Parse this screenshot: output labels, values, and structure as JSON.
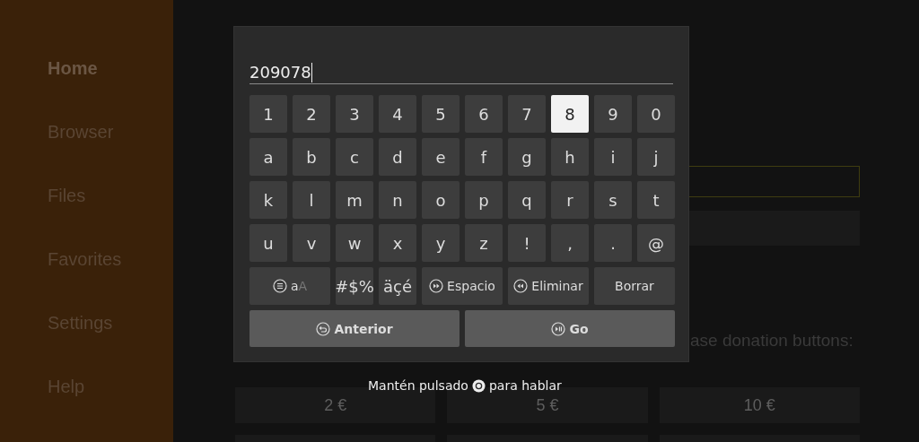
{
  "sidebar": {
    "items": [
      {
        "label": "Home",
        "selected": true
      },
      {
        "label": "Browser",
        "selected": false
      },
      {
        "label": "Files",
        "selected": false
      },
      {
        "label": "Favorites",
        "selected": false
      },
      {
        "label": "Settings",
        "selected": false
      },
      {
        "label": "Help",
        "selected": false
      }
    ]
  },
  "page": {
    "donation_text": "ase donation buttons:",
    "donation_buttons": [
      "2 €",
      "5 €",
      "10 €"
    ]
  },
  "keyboard": {
    "value": "209078",
    "rows": [
      [
        {
          "label": "1",
          "selected": false
        },
        {
          "label": "2",
          "selected": false
        },
        {
          "label": "3",
          "selected": false
        },
        {
          "label": "4",
          "selected": false
        },
        {
          "label": "5",
          "selected": false
        },
        {
          "label": "6",
          "selected": false
        },
        {
          "label": "7",
          "selected": false
        },
        {
          "label": "8",
          "selected": true
        },
        {
          "label": "9",
          "selected": false
        },
        {
          "label": "0",
          "selected": false
        }
      ],
      [
        {
          "label": "a",
          "selected": false
        },
        {
          "label": "b",
          "selected": false
        },
        {
          "label": "c",
          "selected": false
        },
        {
          "label": "d",
          "selected": false
        },
        {
          "label": "e",
          "selected": false
        },
        {
          "label": "f",
          "selected": false
        },
        {
          "label": "g",
          "selected": false
        },
        {
          "label": "h",
          "selected": false
        },
        {
          "label": "i",
          "selected": false
        },
        {
          "label": "j",
          "selected": false
        }
      ],
      [
        {
          "label": "k",
          "selected": false
        },
        {
          "label": "l",
          "selected": false
        },
        {
          "label": "m",
          "selected": false
        },
        {
          "label": "n",
          "selected": false
        },
        {
          "label": "o",
          "selected": false
        },
        {
          "label": "p",
          "selected": false
        },
        {
          "label": "q",
          "selected": false
        },
        {
          "label": "r",
          "selected": false
        },
        {
          "label": "s",
          "selected": false
        },
        {
          "label": "t",
          "selected": false
        }
      ],
      [
        {
          "label": "u",
          "selected": false
        },
        {
          "label": "v",
          "selected": false
        },
        {
          "label": "w",
          "selected": false
        },
        {
          "label": "x",
          "selected": false
        },
        {
          "label": "y",
          "selected": false
        },
        {
          "label": "z",
          "selected": false
        },
        {
          "label": "!",
          "selected": false
        },
        {
          "label": ",",
          "selected": false
        },
        {
          "label": ".",
          "selected": false
        },
        {
          "label": "@",
          "selected": false
        }
      ]
    ],
    "function_keys": [
      {
        "kind": "case",
        "label": "a",
        "alt": "A",
        "selected": false
      },
      {
        "kind": "symbols",
        "label": "#$%",
        "selected": false
      },
      {
        "kind": "accents",
        "label": "äçé",
        "selected": false
      },
      {
        "kind": "space",
        "label": "Espacio",
        "selected": false
      },
      {
        "kind": "delete",
        "label": "Eliminar",
        "selected": false
      },
      {
        "kind": "clear",
        "label": "Borrar",
        "selected": false
      }
    ],
    "actions": [
      {
        "kind": "back",
        "label": "Anterior",
        "selected": false
      },
      {
        "kind": "go",
        "label": "Go",
        "selected": false
      }
    ]
  },
  "hint": {
    "before": "Mantén pulsado",
    "after": "para hablar"
  }
}
